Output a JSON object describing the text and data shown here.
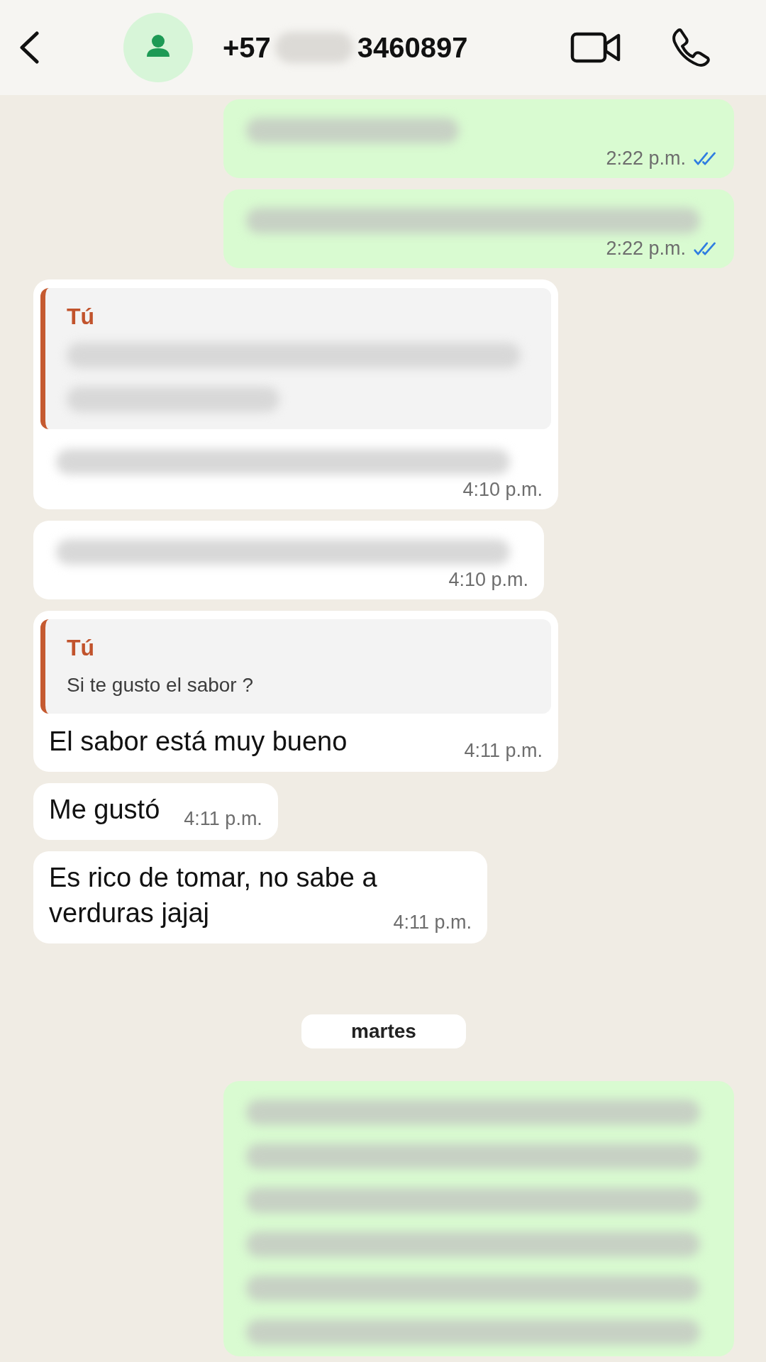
{
  "header": {
    "number_start": "+57",
    "number_end": "3460897"
  },
  "items": [
    {
      "kind": "message",
      "outgoing": true,
      "blurred_lines": [
        {
          "wide": false
        }
      ],
      "time": "2:22 p.m.",
      "read": true
    },
    {
      "kind": "message",
      "outgoing": true,
      "blurred_lines": [
        {
          "wide": true
        }
      ],
      "time": "2:22 p.m.",
      "read": true
    },
    {
      "kind": "message",
      "outgoing": false,
      "quote": {
        "author": "Tú",
        "blurred_lines": [
          {
            "wide": true
          },
          {
            "wide": false
          }
        ]
      },
      "blurred_lines": [
        {
          "wide": true
        }
      ],
      "time": "4:10 p.m."
    },
    {
      "kind": "message",
      "outgoing": false,
      "blurred_lines": [
        {
          "wide": true
        }
      ],
      "time": "4:10 p.m."
    },
    {
      "kind": "message",
      "outgoing": false,
      "quote": {
        "author": "Tú",
        "text": "Si te gusto el sabor ?"
      },
      "text": "El sabor está muy bueno",
      "time": "4:11 p.m."
    },
    {
      "kind": "message",
      "outgoing": false,
      "text": "Me gustó",
      "time": "4:11 p.m."
    },
    {
      "kind": "message",
      "outgoing": false,
      "text": "Es rico de tomar, no sabe a verduras jajaj",
      "time": "4:11 p.m."
    },
    {
      "kind": "date",
      "label": "martes"
    },
    {
      "kind": "message",
      "outgoing": true,
      "blurred_lines": [
        {
          "wide": true
        },
        {
          "wide": true
        },
        {
          "wide": true
        },
        {
          "wide": true
        },
        {
          "wide": true
        },
        {
          "wide": true
        }
      ]
    }
  ]
}
